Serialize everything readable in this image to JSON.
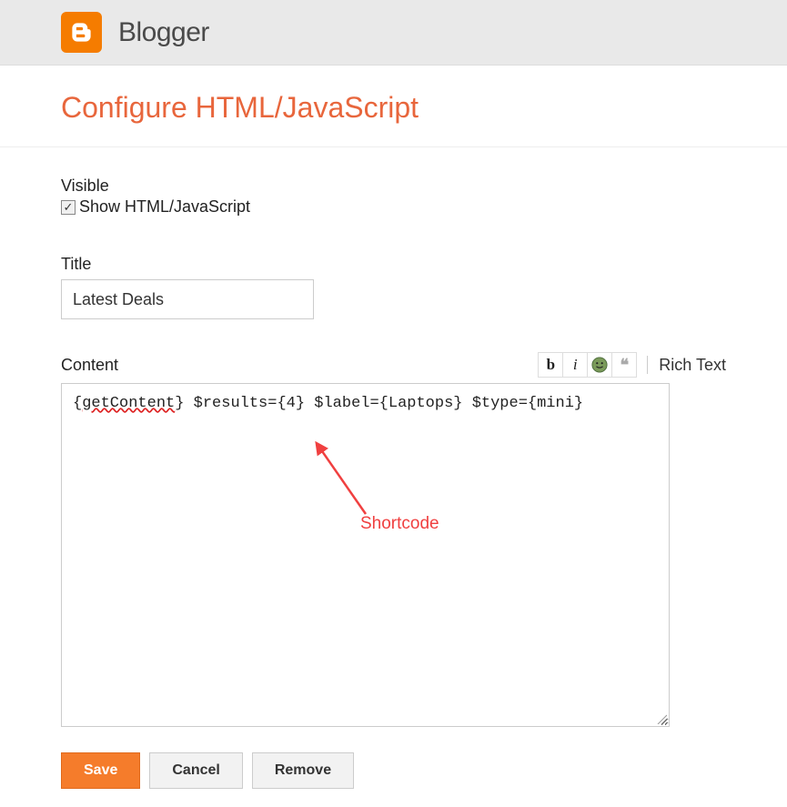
{
  "header": {
    "brand": "Blogger"
  },
  "page": {
    "title": "Configure HTML/JavaScript"
  },
  "form": {
    "visible_label": "Visible",
    "show_checkbox_label": "Show HTML/JavaScript",
    "show_checked": true,
    "title_label": "Title",
    "title_value": "Latest Deals",
    "content_label": "Content",
    "content_value": "{getContent} $results={4} $label={Laptops} $type={mini}",
    "toolbar": {
      "bold": "b",
      "italic": "i",
      "quote": "❝❝",
      "richtext": "Rich Text"
    },
    "annotation": "Shortcode"
  },
  "buttons": {
    "save": "Save",
    "cancel": "Cancel",
    "remove": "Remove"
  }
}
